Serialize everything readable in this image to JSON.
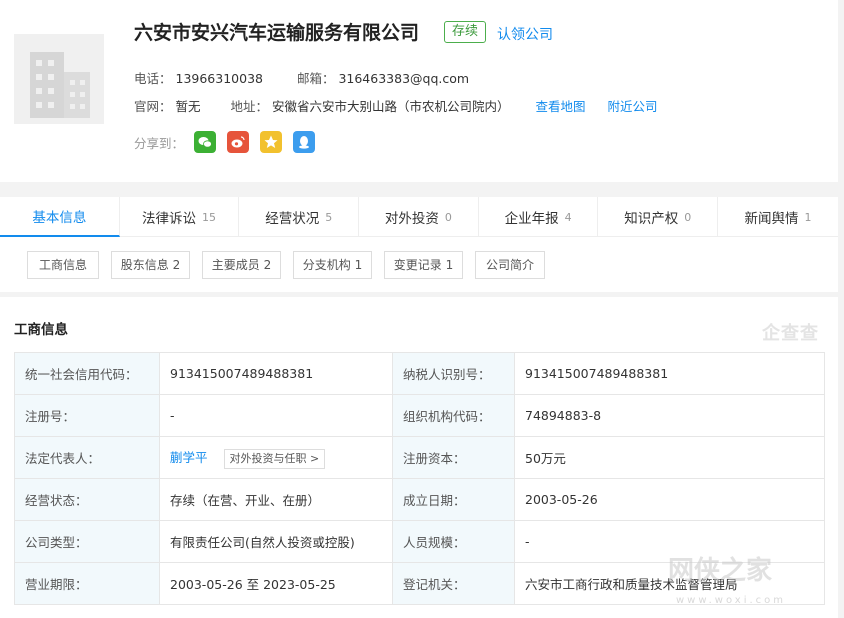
{
  "company": {
    "name": "六安市安兴汽车运输服务有限公司",
    "status_badge": "存续",
    "claim_link": "认领公司",
    "phone_label": "电话：",
    "phone": "13966310038",
    "email_label": "邮箱：",
    "email": "316463383@qq.com",
    "website_label": "官网：",
    "website": "暂无",
    "address_label": "地址：",
    "address": "安徽省六安市大别山路（市农机公司院内）",
    "map_link": "查看地图",
    "nearby_link": "附近公司",
    "share_label": "分享到："
  },
  "share_icons": [
    "wechat-icon",
    "weibo-icon",
    "qzone-star-icon",
    "qq-icon"
  ],
  "tabs": [
    {
      "label": "基本信息",
      "count": ""
    },
    {
      "label": "法律诉讼",
      "count": "15"
    },
    {
      "label": "经营状况",
      "count": "5"
    },
    {
      "label": "对外投资",
      "count": "0"
    },
    {
      "label": "企业年报",
      "count": "4"
    },
    {
      "label": "知识产权",
      "count": "0"
    },
    {
      "label": "新闻舆情",
      "count": "1"
    }
  ],
  "subtabs": [
    "工商信息",
    "股东信息 2",
    "主要成员 2",
    "分支机构 1",
    "变更记录 1",
    "公司简介"
  ],
  "section": {
    "title": "工商信息",
    "watermark": "企查查"
  },
  "rows": [
    {
      "l1": "统一社会信用代码：",
      "v1": "913415007489488381",
      "l2": "纳税人识别号：",
      "v2": "913415007489488381"
    },
    {
      "l1": "注册号：",
      "v1": "-",
      "l2": "组织机构代码：",
      "v2": "74894883-8"
    },
    {
      "l1": "法定代表人：",
      "v1": "蒯学平",
      "l2": "注册资本：",
      "v2": "50万元"
    },
    {
      "l1": "经营状态：",
      "v1": "存续（在营、开业、在册）",
      "l2": "成立日期：",
      "v2": "2003-05-26"
    },
    {
      "l1": "公司类型：",
      "v1": "有限责任公司(自然人投资或控股)",
      "l2": "人员规模：",
      "v2": "-"
    },
    {
      "l1": "营业期限：",
      "v1": "2003-05-26 至 2023-05-25",
      "l2": "登记机关：",
      "v2": "六安市工商行政和质量技术监督管理局"
    }
  ],
  "person_button": "对外投资与任职 >",
  "site_watermark": "网侠之家",
  "site_watermark_url": "www.woxi.com",
  "colors": {
    "accent": "#128bed",
    "status_green": "#3c9a3c",
    "label_bg": "#f2f9fc"
  }
}
